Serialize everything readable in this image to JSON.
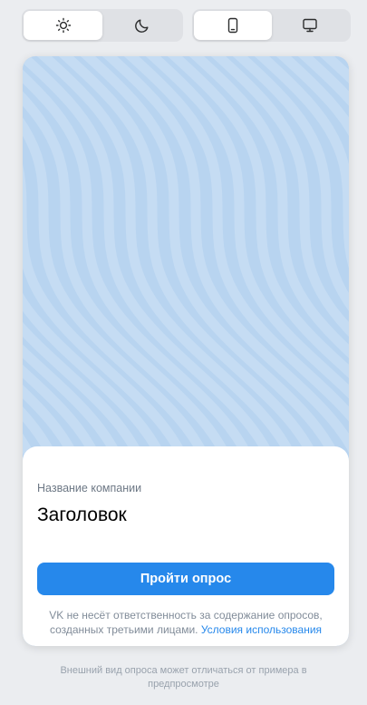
{
  "toolbar": {
    "theme_options": [
      {
        "icon": "sun-icon",
        "active": true
      },
      {
        "icon": "moon-icon",
        "active": false
      }
    ],
    "device_options": [
      {
        "icon": "phone-icon",
        "active": true
      },
      {
        "icon": "desktop-icon",
        "active": false
      }
    ]
  },
  "card": {
    "cover_color": "#b8d4f0",
    "company_name": "Название компании",
    "heading": "Заголовок",
    "button_label": "Пройти опрос",
    "disclaimer_text": "VK не несёт ответственность за содержание опросов, созданных третьими лицами.",
    "terms_link": "Условия использования"
  },
  "footnote": "Внешний вид опроса может отличаться от примера в предпросмотре",
  "colors": {
    "accent": "#2688eb",
    "page_bg": "#ebedf0"
  }
}
